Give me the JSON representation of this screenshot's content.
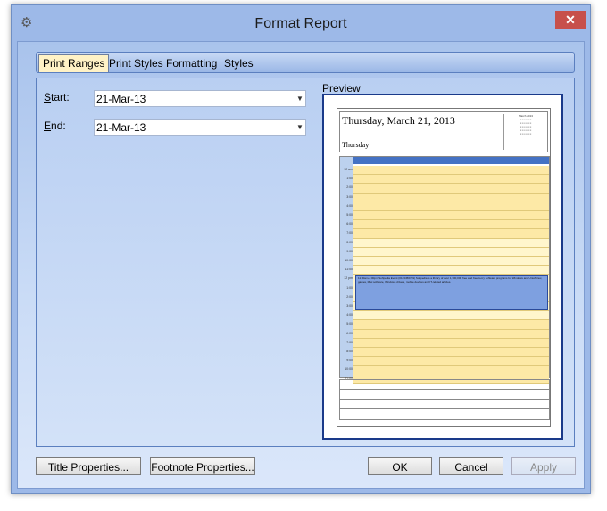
{
  "window": {
    "title": "Format Report"
  },
  "tabs": [
    {
      "label": "Print Ranges"
    },
    {
      "label": "Print Styles"
    },
    {
      "label": "Formatting"
    },
    {
      "label": "Styles"
    }
  ],
  "fields": {
    "start": {
      "label_prefix": "S",
      "label_rest": "tart:",
      "value": "21-Mar-13"
    },
    "end": {
      "label_prefix": "E",
      "label_rest": "nd:",
      "value": "21-Mar-13"
    }
  },
  "preview": {
    "label": "Preview",
    "date_heading": "Thursday, March 21, 2013",
    "day_name": "Thursday",
    "mini_calendar_title": "March 2013",
    "times": [
      "12 am",
      "1:00",
      "2:00",
      "3:00",
      "4:00",
      "5:00",
      "6:00",
      "7:00",
      "8:00",
      "9:00",
      "10:00",
      "11:00",
      "12 pm",
      "1:00",
      "2:00",
      "3:00",
      "4:00",
      "5:00",
      "6:00",
      "7:00",
      "8:00",
      "9:00",
      "10:00",
      "11:00"
    ],
    "event_text": "11:00am-4:00pm Softpedia Event (0123456789) Softpedia is a library of over 1,300,000 free and free-to-try software programs for Windows and Unix/Linux, games, Mac software, Windows drivers, mobile devices and IT-related articles."
  },
  "buttons": {
    "title_properties": "Title Properties...",
    "footnote_properties": "Footnote Properties...",
    "ok": "OK",
    "cancel": "Cancel",
    "apply": "Apply"
  }
}
